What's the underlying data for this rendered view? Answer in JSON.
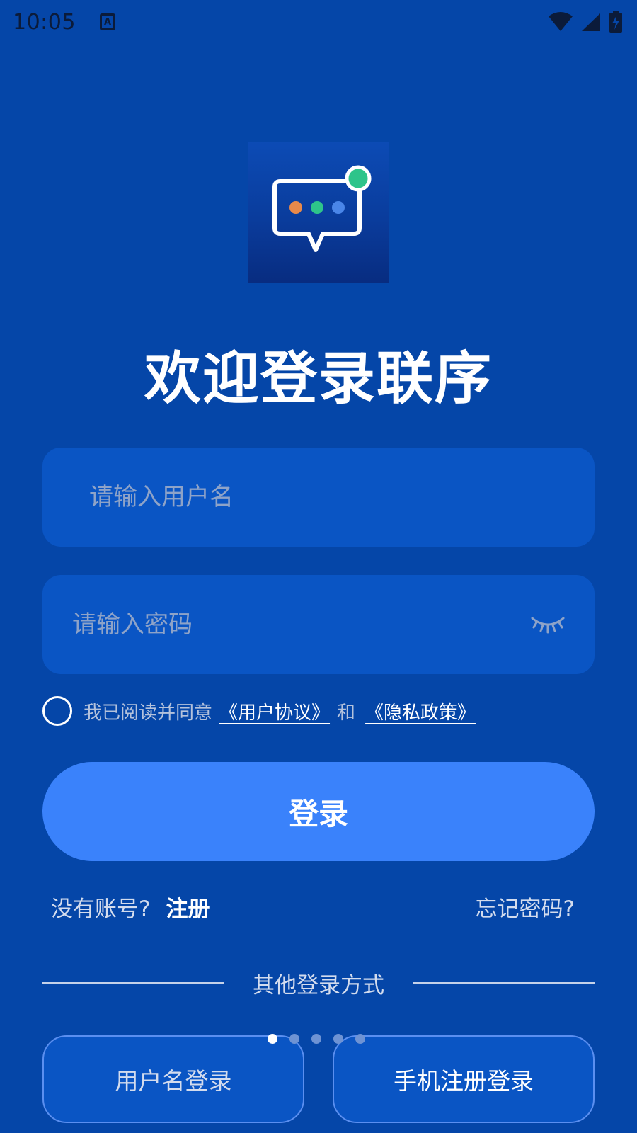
{
  "status_bar": {
    "time": "10:05",
    "indicator_letter": "A",
    "icons": [
      "wifi-icon",
      "signal-icon",
      "battery-charging-icon"
    ]
  },
  "logo": {
    "icon": "chat-bubble-icon",
    "dot_colors": [
      "#e8894a",
      "#2ec48a",
      "#4a86e8"
    ],
    "badge_color": "#2ec48a"
  },
  "title": "欢迎登录联序",
  "username": {
    "placeholder": "请输入用户名",
    "value": ""
  },
  "password": {
    "placeholder": "请输入密码",
    "value": "",
    "toggle_icon": "eye-closed-icon"
  },
  "agreement": {
    "checked": false,
    "prefix": "我已阅读并同意",
    "user_agreement": "《用户协议》",
    "and": "和",
    "privacy_policy": "《隐私政策》"
  },
  "login_button": "登录",
  "links": {
    "no_account": "没有账号?",
    "register": "注册",
    "forgot_password": "忘记密码?"
  },
  "divider_text": "其他登录方式",
  "pager": {
    "count": 5,
    "active": 0
  },
  "alt_login": {
    "username_login": "用户名登录",
    "phone_login": "手机注册登录"
  },
  "colors": {
    "background": "#0546a8",
    "input_bg": "#0a55c4",
    "primary_button": "#3a82fb"
  }
}
